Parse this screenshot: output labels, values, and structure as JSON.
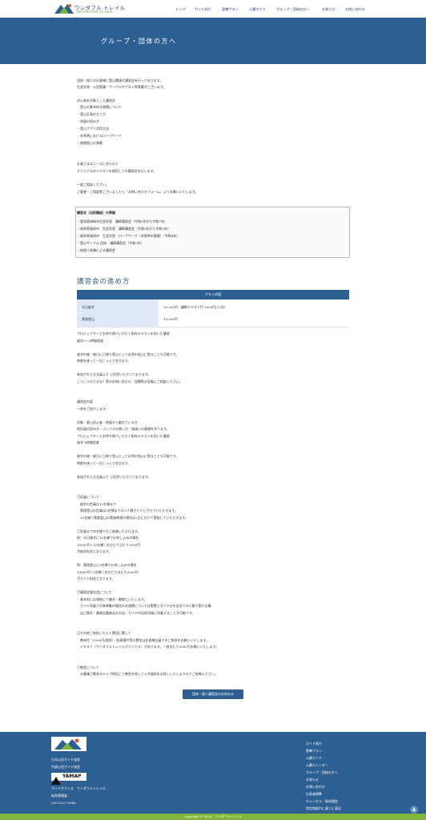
{
  "header": {
    "brand_name": "ワンダフル トレイル",
    "brand_sub": "MOUNTAIN GUIDE",
    "nav": [
      "トップ",
      "ガイド紹介",
      "登攀プラン",
      "公募ガイド",
      "グループ・団体の方へ",
      "お知らせ",
      "お問い合わせ"
    ]
  },
  "hero": {
    "title": "グループ・団体の方へ"
  },
  "intro": [
    "団体・個人のお客様に登山関連の講習会を行っております。",
    "生涯学習・公民館講・サークルやゲスト等実績がございます。",
    "",
    "初心者を対象とした講習会",
    "・登山の基本的な装備について",
    "・登山計画の立て方",
    "・地図の読み方",
    "・登山アプリ活用方法",
    "・非常時におけるロープワーク",
    "・夜間登山の装備",
    "",
    "お客さまのニーズに合わせた",
    "オリジナルのテキストを使用しての講習会を行います。",
    "",
    "一度ご相談ください。",
    "ご要望・ご相談等ございましたら「お問い合わせフォーム」よりお願いいたします。"
  ],
  "record_box": {
    "title": "講習会（出前講座）の実績",
    "items": [
      "・愛知県岡崎市生涯学習　講師講習会（令和5年から令和7年）",
      "・岐阜県瑞浪市　生涯学習　講師講習会（令和3年から令和5年）",
      "・岐阜県瑞浪市　生涯学習　ロープワーク（非常時の基礎）（令和4年）",
      "・登山サークル 団体　講師講習会（令和7年）",
      "・他個人依頼による講習会"
    ]
  },
  "section_title": "講習会の進め方",
  "plan_table": {
    "header": "プラン内容",
    "rows": [
      {
        "label": "半日座学",
        "value": "10,000円（講師テキスト代 3000円/人/別）"
      },
      {
        "label": "実践登山",
        "value": "10,000円"
      }
    ]
  },
  "body_text": [
    "プロジェクターとお持ち帰りいただく配布テキストを用いた講習",
    "座学2～3時間程度",
    "",
    "座学の後・後日に日帰り登山として近郊の低山に登ることも可能です。",
    "時間を使って一日じっくり学びます。",
    "",
    "参加された方全員より ご好評いただいております。",
    "こういうのできる？等のお問い合わせ・見積等お気軽にご相談ください。",
    "",
    "",
    "講習会内容",
    "一例をご紹介します。",
    "",
    "対象：登山初心者・地図から離れている方",
    "地形図の読み方・コンパスの使い方・道迷いの基礎を学べます。",
    "プロジェクターとお持ち帰りいただく配布テキストを用いた講習",
    "座学 4時間程度",
    "",
    "座学の後・後日に日帰り登山として近郊の低山に登ることも可能です。",
    "時間を使って一日じっくり学びます。",
    "",
    "参加された方全員より ご好評いただいております。",
    "",
    "",
    "〇定員について",
    "　座学の定員は10名様まで",
    "　実践登山の定員は5名様までの少人数ガイドとさせていただきます。",
    "　10名様で実践登山の実施希望の場合は2日に分けて実施していただきます。",
    "",
    "〇定員まで何名様でもご依頼いただけます。",
    "例：半日座学に10名様でお申し込みの場合",
    "10000円÷10名様＝おひとり当たり1000円",
    "が座学料金となります。",
    "",
    "例：実践登山に5名様でお申し込みの場合",
    "10000円÷5名様＝おひとり当たり2000円",
    "がガイド料金となります。",
    "",
    "〇講習会場全会について",
    "　基本的には現地にて集合・解散といたします。",
    "　ガイド同乗での車移動の場合の交通費については実費とガイド分を含めての人数で割り計算",
    "　自己責任・事故記載無念の方は、ガイドの自家用車に同乗することが可能です。",
    "",
    "",
    "〇その他ご負担いただく費用に関して",
    "　教材代（1000円/個別）・駐車場代等の費用はお客様全員でのご負担をお願いいたします。",
    "　テキスト（ワンダフルトレイルオリジナル）があります。一部当たり3000円お願いいたします。",
    "",
    "",
    "〇教室について",
    "　お客様ご都合のキャプ地区にて教室を探して公共施設をお探しいたしますのでご依頼ください。"
  ],
  "cta_button": "団体・個人講習会のお申込み",
  "footer": {
    "left": [
      "日本山岳ガイド協会",
      "中部山岳ガイド協会",
      "",
      "",
      "",
      "ガイドオフィス　ワンダフルトレイル",
      "岐阜県揖斐",
      "090-0227-0040"
    ],
    "yamap": "YAMAP",
    "right": [
      "ガイド紹介",
      "登攀プラン",
      "公募ガイド",
      "公募カレンダー",
      "グループ・団体の方へ",
      "お知らせ",
      "お問い合わせ",
      "比表者規準",
      "特定商取引に基づく表記"
    ],
    "right_extra": "キャンセル・取消規定",
    "copyright": "Copyright © 2025　ワンダフルトレイル"
  }
}
